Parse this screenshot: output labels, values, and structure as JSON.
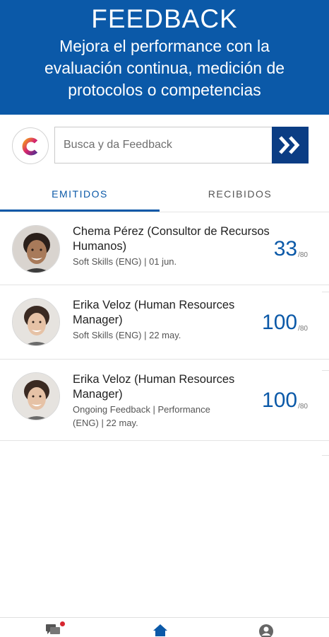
{
  "header": {
    "title": "FEEDBACK",
    "subtitle": "Mejora el performance con la evaluación continua, medición de protocolos o competencias"
  },
  "search": {
    "placeholder": "Busca y da Feedback",
    "logo_letter": "C",
    "button_icon": "double-chevron-right-icon"
  },
  "tabs": [
    {
      "label": "EMITIDOS",
      "active": true
    },
    {
      "label": "RECIBIDOS",
      "active": false
    }
  ],
  "feedback_items": [
    {
      "name": "Chema Pérez (Consultor de Recursos Humanos)",
      "meta": "Soft Skills  (ENG) | 01 jun.",
      "score": "33",
      "max": "/80"
    },
    {
      "name": "Erika Veloz (Human Resources Manager)",
      "meta": "Soft Skills  (ENG) | 22 may.",
      "score": "100",
      "max": "/80"
    },
    {
      "name": "Erika Veloz (Human Resources Manager)",
      "meta": "Ongoing Feedback | Performance (ENG) | 22 may.",
      "score": "100",
      "max": "/80"
    }
  ],
  "bottom_nav": {
    "items": [
      "chat-icon",
      "home-icon",
      "profile-icon"
    ],
    "notification_color": "#d7262f"
  },
  "colors": {
    "primary": "#0b59a8",
    "button_dark": "#0b3d84"
  }
}
